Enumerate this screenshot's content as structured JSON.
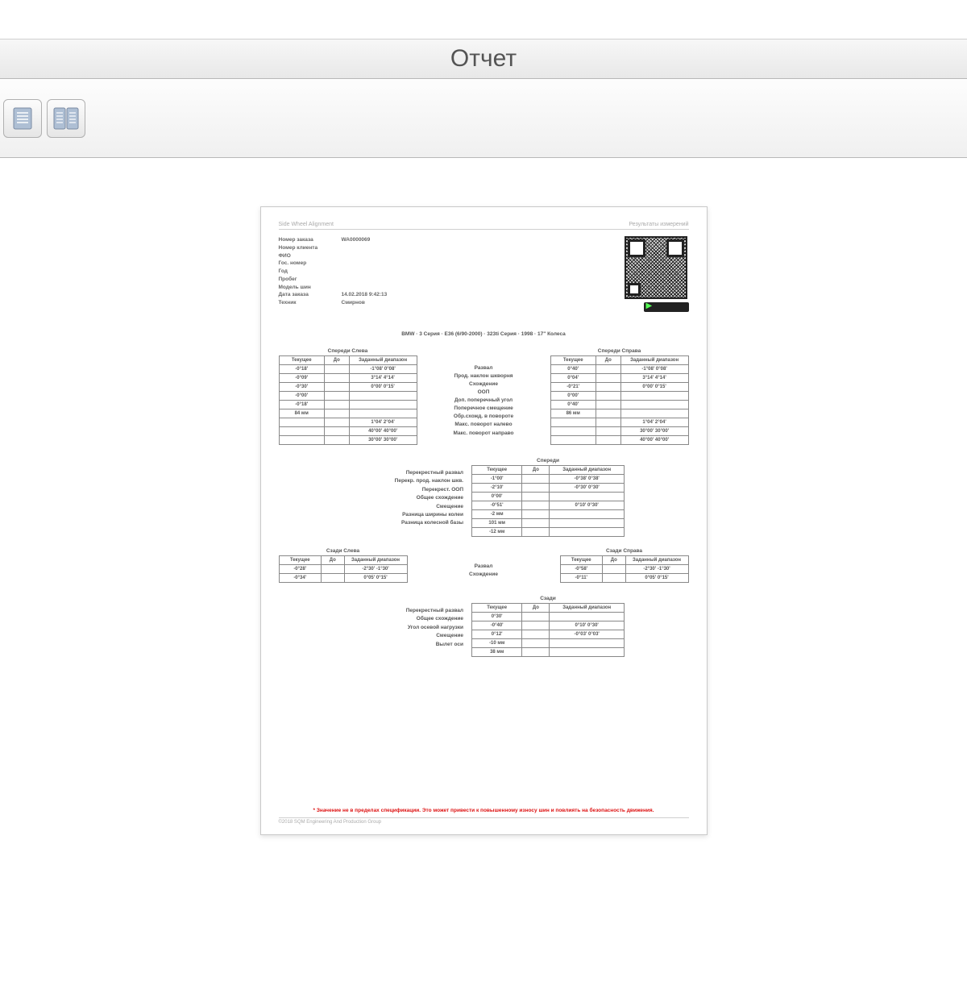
{
  "window": {
    "title": "Отчет"
  },
  "page_header": {
    "left": "Side Wheel Alignment",
    "right": "Результаты измерений"
  },
  "info": {
    "order_no_label": "Номер заказа",
    "order_no": "WA0000069",
    "client_no_label": "Номер клиента",
    "name_label": "ФИО",
    "plate_label": "Гос. номер",
    "year_label": "Год",
    "mileage_label": "Пробег",
    "tire_label": "Модель шин",
    "date_label": "Дата заказа",
    "date": "14.02.2018 9:42:13",
    "tech_label": "Техник",
    "tech": "Смирнов"
  },
  "vehicle_line": "BMW · 3 Серия · E36 (6/90-2000) · 323ti Серия · 1998 · 17\" Колеса",
  "col_headers": [
    "Текущее",
    "До",
    "Заданный диапазон"
  ],
  "front": {
    "left_title": "Спереди Слева",
    "right_title": "Спереди Справа",
    "labels": [
      "Развал",
      "Прод. наклон шкворня",
      "Схождение",
      "ООП",
      "Доп. поперечный угол",
      "Поперечное смещение",
      "Обр.схожд. в повороте",
      "Макс. поворот налево",
      "Макс. поворот направо"
    ],
    "left": [
      {
        "cur": "-0°18'",
        "cur_cls": "green",
        "bef": "",
        "rng": "-1°08'  0°08'"
      },
      {
        "cur": "-0°09'",
        "cur_cls": "red",
        "bef": "",
        "rng": "3°14'  4°14'"
      },
      {
        "cur": "-0°30'",
        "cur_cls": "red",
        "bef": "",
        "rng": "0°00'  0°15'"
      },
      {
        "cur": "-0°00'",
        "bef": "",
        "rng": ""
      },
      {
        "cur": "-0°18'",
        "bef": "",
        "rng": ""
      },
      {
        "cur": "84 мм",
        "bef": "",
        "rng": ""
      },
      {
        "cur": "",
        "bef": "",
        "rng": "1°04'  2°04'"
      },
      {
        "cur": "",
        "bef": "",
        "rng": "40°00'  40°00'"
      },
      {
        "cur": "",
        "bef": "",
        "rng": "30°00'  30°00'"
      }
    ],
    "right": [
      {
        "cur": "0°40'",
        "cur_cls": "red",
        "bef": "",
        "rng": "-1°08'  0°08'"
      },
      {
        "cur": "0°04'",
        "cur_cls": "red",
        "bef": "",
        "rng": "3°14'  4°14'"
      },
      {
        "cur": "-0°21'",
        "cur_cls": "red",
        "bef": "",
        "rng": "0°00'  0°15'"
      },
      {
        "cur": "0°00'",
        "bef": "",
        "rng": ""
      },
      {
        "cur": "0°40'",
        "bef": "",
        "rng": ""
      },
      {
        "cur": "86 мм",
        "bef": "",
        "rng": ""
      },
      {
        "cur": "",
        "bef": "",
        "rng": "1°04'  2°04'"
      },
      {
        "cur": "",
        "bef": "",
        "rng": "30°00'  30°00'"
      },
      {
        "cur": "",
        "bef": "",
        "rng": "40°00'  40°00'"
      }
    ]
  },
  "front_center": {
    "title": "Спереди",
    "labels": [
      "Перекрестный развал",
      "Перекр. прод. наклон шкв.",
      "Перекрест. ООП",
      "Общее схождение",
      "Смещение",
      "Разница ширины колеи",
      "Разница колесной базы"
    ],
    "rows": [
      {
        "cur": "-1°00'",
        "cur_cls": "red",
        "bef": "",
        "rng": "-0°38'  0°38'"
      },
      {
        "cur": "-2°10'",
        "cur_cls": "red",
        "bef": "",
        "rng": "-0°30'  0°30'"
      },
      {
        "cur": "0°00'",
        "bef": "",
        "rng": ""
      },
      {
        "cur": "-0°51'",
        "cur_cls": "red",
        "bef": "",
        "rng": "0°10'  0°30'"
      },
      {
        "cur": "-2 мм",
        "bef": "",
        "rng": ""
      },
      {
        "cur": "101 мм",
        "bef": "",
        "rng": ""
      },
      {
        "cur": "-12 мм",
        "bef": "",
        "rng": ""
      }
    ]
  },
  "rear": {
    "left_title": "Сзади Слева",
    "right_title": "Сзади Справа",
    "labels": [
      "Развал",
      "Схождение"
    ],
    "left": [
      {
        "cur": "-0°28'",
        "cur_cls": "red",
        "bef": "",
        "rng": "-2°30'  -1°30'"
      },
      {
        "cur": "-0°34'",
        "cur_cls": "red",
        "bef": "",
        "rng": "0°05'  0°15'"
      }
    ],
    "right": [
      {
        "cur": "-0°58'",
        "cur_cls": "red",
        "bef": "",
        "rng": "-2°30'  -1°30'"
      },
      {
        "cur": "-0°11'",
        "cur_cls": "red",
        "bef": "",
        "rng": "0°05'  0°15'"
      }
    ]
  },
  "rear_center": {
    "title": "Сзади",
    "labels": [
      "Перекрестный развал",
      "Общее схождение",
      "Угол осевой нагрузки",
      "Смещение",
      "Вылет оси"
    ],
    "rows": [
      {
        "cur": "0°30'",
        "bef": "",
        "rng": ""
      },
      {
        "cur": "-0°40'",
        "cur_cls": "red",
        "bef": "",
        "rng": "0°10'  0°30'"
      },
      {
        "cur": "0°12'",
        "cur_cls": "green",
        "bef": "",
        "rng": "-0°03'  0°03'"
      },
      {
        "cur": "-10 мм",
        "bef": "",
        "rng": ""
      },
      {
        "cur": "38 мм",
        "bef": "",
        "rng": ""
      }
    ]
  },
  "warning": "* Значение не в пределах спецификации. Это может привести к повышенному износу шин и повлиять на безопасность движения.",
  "footer": "©2018 SQM Engineering And Production Group"
}
